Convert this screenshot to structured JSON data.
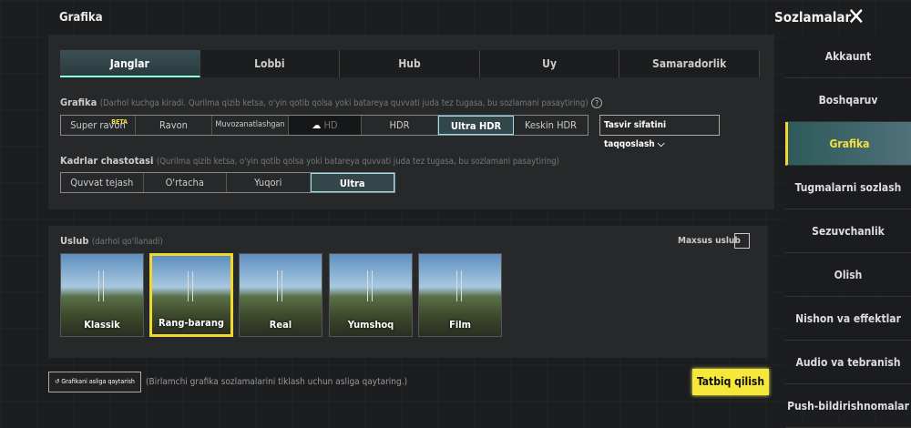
{
  "header": {
    "title": "Grafika",
    "settings": "Sozlamalar"
  },
  "tabs": [
    "Janglar",
    "Lobbi",
    "Hub",
    "Uy",
    "Samaradorlik"
  ],
  "graphics": {
    "label": "Grafika",
    "hint": "(Darhol kuchga kiradi. Qurilma qizib ketsa, o'yin qotib qolsa yoki batareya quvvati juda tez tugasa, bu sozlamani pasaytiring)",
    "help": "?",
    "beta": "BETA",
    "options": [
      "Super ravon",
      "Ravon",
      "Muvozanatlashgan",
      "HD",
      "HDR",
      "Ultra HDR",
      "Keskin HDR"
    ],
    "selected": "Ultra HDR",
    "compare": "Tasvir sifatini taqqoslash"
  },
  "fps": {
    "label": "Kadrlar chastotasi",
    "hint": "(Qurilma qizib ketsa, o'yin qotib qolsa yoki batareya quvvati juda tez tugasa, bu sozlamani pasaytiring)",
    "options": [
      "Quvvat tejash",
      "O'rtacha",
      "Yuqori",
      "Ultra"
    ],
    "selected": "Ultra"
  },
  "style": {
    "label": "Uslub",
    "hint": "(darhol qo'llanadi)",
    "custom": "Maxsus uslub",
    "options": [
      "Klassik",
      "Rang-barang",
      "Real",
      "Yumshoq",
      "Film"
    ],
    "selected": "Rang-barang"
  },
  "footer": {
    "reset": "Grafikani asliga qaytarish",
    "reset_hint": "(Birlamchi grafika sozlamalarini tiklash uchun asliga qaytaring.)",
    "apply": "Tatbiq qilish"
  },
  "sidebar": [
    "Akkaunt",
    "Boshqaruv",
    "Grafika",
    "Tugmalarni sozlash",
    "Sezuvchanlik",
    "Olish",
    "Nishon va effektlar",
    "Audio va tebranish",
    "Push-bildirishnomalar"
  ],
  "colors": {
    "accent": "#f5e83a",
    "selected": "#9de"
  }
}
